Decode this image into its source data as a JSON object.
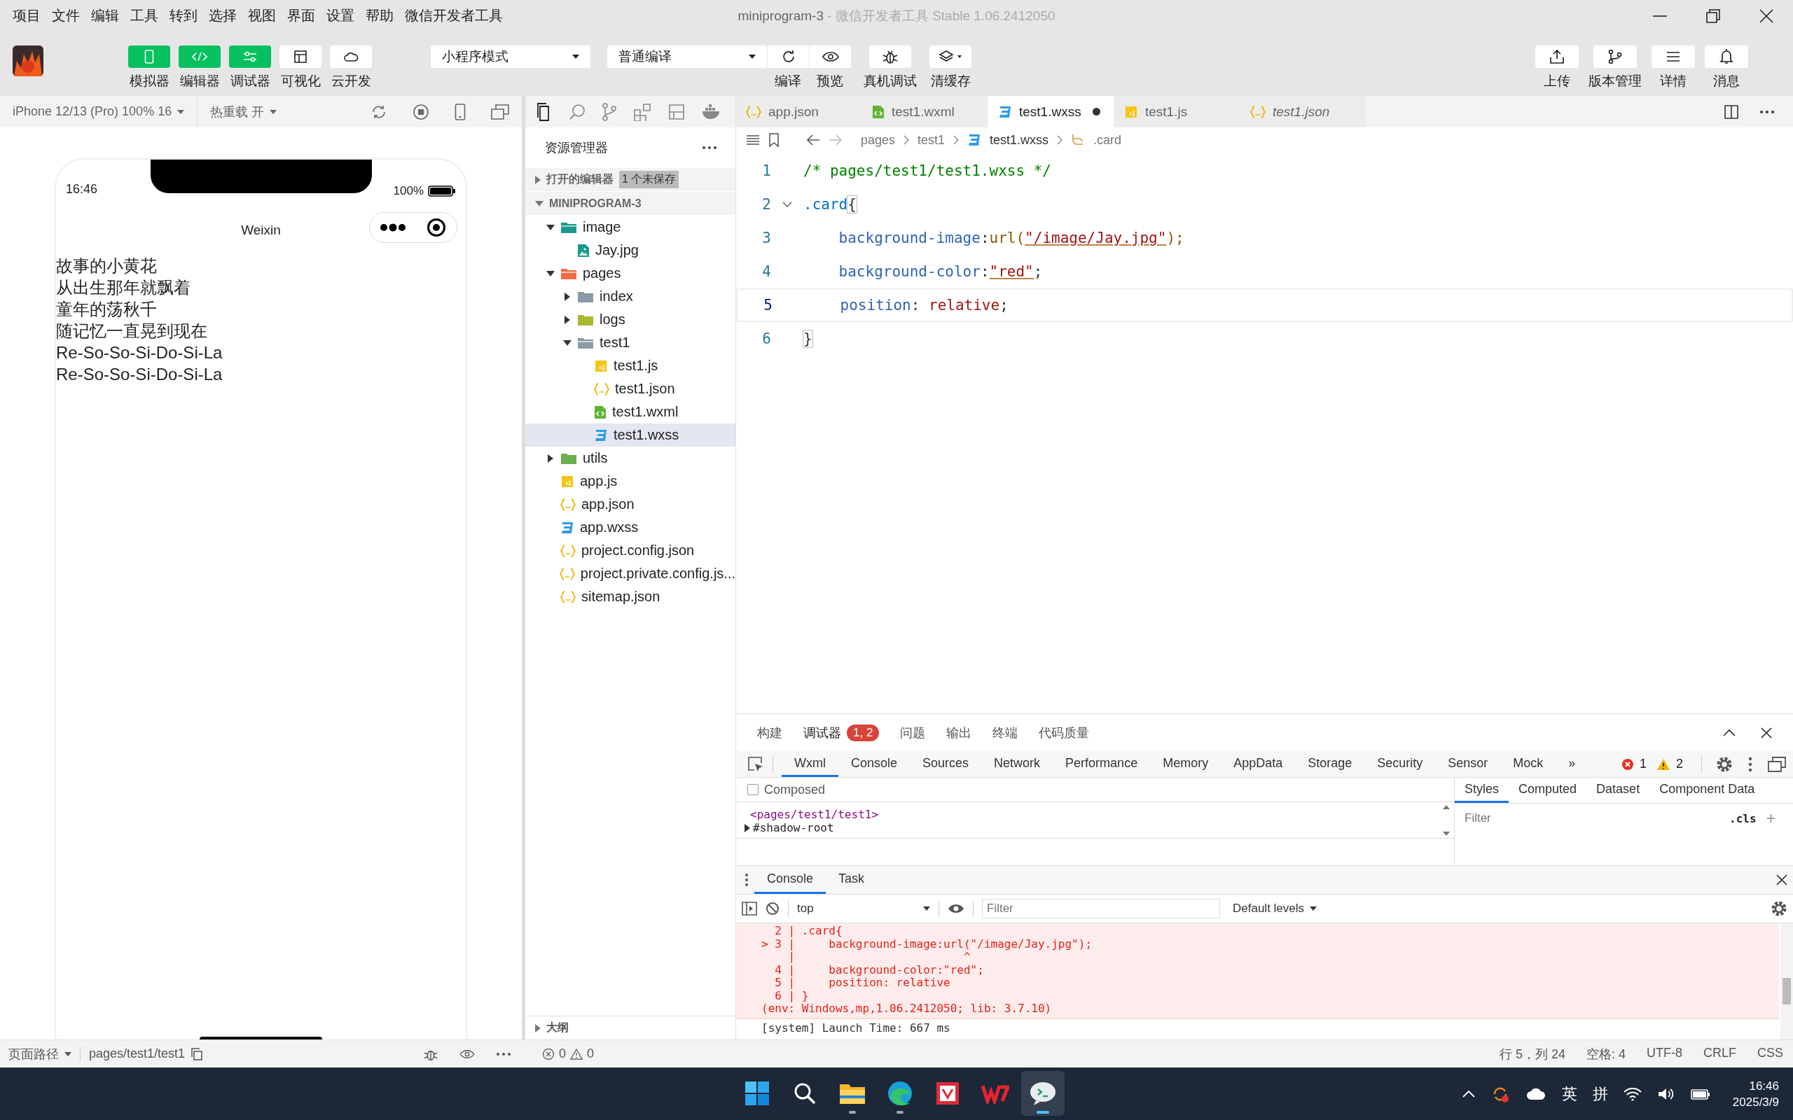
{
  "menu": [
    "项目",
    "文件",
    "编辑",
    "工具",
    "转到",
    "选择",
    "视图",
    "界面",
    "设置",
    "帮助",
    "微信开发者工具"
  ],
  "window": {
    "title": "miniprogram-3",
    "subtitle": "- 微信开发者工具 Stable 1.06.2412050"
  },
  "toolbar": {
    "views": [
      {
        "label": "模拟器",
        "selected": true
      },
      {
        "label": "编辑器",
        "selected": true
      },
      {
        "label": "调试器",
        "selected": true
      },
      {
        "label": "可视化",
        "selected": false
      },
      {
        "label": "云开发",
        "selected": false
      }
    ],
    "mode": "小程序模式",
    "compile": "普通编译",
    "actions": [
      "编译",
      "预览",
      "真机调试",
      "清缓存"
    ],
    "right": [
      "上传",
      "版本管理",
      "详情",
      "消息"
    ]
  },
  "simulator": {
    "device": "iPhone 12/13 (Pro) 100% 16",
    "hot_reload": "热重载 开",
    "time": "16:46",
    "battery": "100%",
    "nav_title": "Weixin",
    "lines": [
      "故事的小黄花",
      "从出生那年就飘着",
      "童年的荡秋千",
      "随记忆一直晃到现在",
      "Re-So-So-Si-Do-Si-La",
      "Re-So-So-Si-Do-Si-La"
    ]
  },
  "explorer": {
    "title": "资源管理器",
    "open_editors": "打开的编辑器",
    "unsaved": "1 个未保存",
    "project": "MINIPROGRAM-3",
    "outline": "大纲",
    "tree": [
      {
        "name": "image",
        "kind": "folder",
        "color": "#1a9a8a",
        "expanded": true,
        "selected": false,
        "children": [
          {
            "name": "Jay.jpg",
            "kind": "image",
            "selected": false
          }
        ]
      },
      {
        "name": "pages",
        "kind": "folder",
        "color": "#f06a45",
        "expanded": true,
        "selected": false,
        "children": [
          {
            "name": "index",
            "kind": "folder",
            "color": "#8a9aa8",
            "expanded": false,
            "selected": false
          },
          {
            "name": "logs",
            "kind": "folder",
            "color": "#a8b830",
            "expanded": false,
            "selected": false
          },
          {
            "name": "test1",
            "kind": "folder",
            "color": "#8a9aa8",
            "expanded": true,
            "selected": false,
            "children": [
              {
                "name": "test1.js",
                "kind": "js",
                "selected": false
              },
              {
                "name": "test1.json",
                "kind": "json",
                "selected": false
              },
              {
                "name": "test1.wxml",
                "kind": "wxml",
                "selected": false
              },
              {
                "name": "test1.wxss",
                "kind": "wxss",
                "selected": true
              }
            ]
          }
        ]
      },
      {
        "name": "utils",
        "kind": "folder",
        "color": "#6ab04c",
        "expanded": false,
        "selected": false
      },
      {
        "name": "app.js",
        "kind": "js",
        "selected": false
      },
      {
        "name": "app.json",
        "kind": "json",
        "selected": false
      },
      {
        "name": "app.wxss",
        "kind": "wxss",
        "selected": false
      },
      {
        "name": "project.config.json",
        "kind": "json",
        "selected": false
      },
      {
        "name": "project.private.config.js...",
        "kind": "json",
        "selected": false
      },
      {
        "name": "sitemap.json",
        "kind": "json",
        "selected": false
      }
    ]
  },
  "editor": {
    "tabs": [
      {
        "label": "app.json",
        "kind": "json",
        "selected": false,
        "preview": false,
        "modified": false
      },
      {
        "label": "test1.wxml",
        "kind": "wxml",
        "selected": false,
        "preview": false,
        "modified": false
      },
      {
        "label": "test1.wxss",
        "kind": "wxss",
        "selected": true,
        "preview": false,
        "modified": true
      },
      {
        "label": "test1.js",
        "kind": "js",
        "selected": false,
        "preview": false,
        "modified": false
      },
      {
        "label": "test1.json",
        "kind": "json",
        "selected": false,
        "preview": true,
        "modified": false
      }
    ],
    "breadcrumb": [
      "pages",
      "test1",
      "test1.wxss",
      ".card"
    ],
    "lines": [
      {
        "number": "1",
        "current": false,
        "tokens": [
          {
            "text": "/* pages/test1/test1.wxss */",
            "kind": "comment"
          }
        ]
      },
      {
        "number": "2",
        "current": false,
        "tokens": [
          {
            "text": ".card",
            "kind": "selector"
          },
          {
            "text": "{",
            "kind": "bracket"
          }
        ]
      },
      {
        "number": "3",
        "current": false,
        "tokens": [
          {
            "text": "    background-image",
            "kind": "property"
          },
          {
            "text": ":",
            "kind": "punct"
          },
          {
            "text": "url(",
            "kind": "func"
          },
          {
            "text": "\"/image/Jay.jpg\"",
            "kind": "string"
          },
          {
            "text": ");",
            "kind": "func"
          }
        ]
      },
      {
        "number": "4",
        "current": false,
        "tokens": [
          {
            "text": "    background-color",
            "kind": "property"
          },
          {
            "text": ":",
            "kind": "punct"
          },
          {
            "text": "\"red\"",
            "kind": "string"
          },
          {
            "text": ";",
            "kind": "punct"
          }
        ]
      },
      {
        "number": "5",
        "current": true,
        "tokens": [
          {
            "text": "    position",
            "kind": "property"
          },
          {
            "text": ": ",
            "kind": "punct"
          },
          {
            "text": "relative",
            "kind": "value"
          },
          {
            "text": ";",
            "kind": "punct"
          }
        ]
      },
      {
        "number": "6",
        "current": false,
        "tokens": [
          {
            "text": "}",
            "kind": "bracket"
          }
        ]
      }
    ]
  },
  "debugger": {
    "tabs": [
      {
        "label": "构建",
        "selected": false
      },
      {
        "label": "调试器",
        "selected": true,
        "badge": "1, 2"
      },
      {
        "label": "问题",
        "selected": false
      },
      {
        "label": "输出",
        "selected": false
      },
      {
        "label": "终端",
        "selected": false
      },
      {
        "label": "代码质量",
        "selected": false
      }
    ],
    "devtools_tabs": [
      {
        "label": "Wxml",
        "selected": true
      },
      {
        "label": "Console",
        "selected": false
      },
      {
        "label": "Sources",
        "selected": false
      },
      {
        "label": "Network",
        "selected": false
      },
      {
        "label": "Performance",
        "selected": false
      },
      {
        "label": "Memory",
        "selected": false
      },
      {
        "label": "AppData",
        "selected": false
      },
      {
        "label": "Storage",
        "selected": false
      },
      {
        "label": "Security",
        "selected": false
      },
      {
        "label": "Sensor",
        "selected": false
      },
      {
        "label": "Mock",
        "selected": false
      }
    ],
    "more": "»",
    "errors": "1",
    "warnings": "2",
    "composed": {
      "label": "Composed",
      "checked": false
    },
    "wxml": {
      "tag": "<pages/test1/test1>",
      "child": "#shadow-root"
    },
    "style_tabs": [
      {
        "label": "Styles",
        "selected": true
      },
      {
        "label": "Computed",
        "selected": false
      },
      {
        "label": "Dataset",
        "selected": false
      },
      {
        "label": "Component Data",
        "selected": false
      }
    ],
    "style_filter": {
      "placeholder": "Filter"
    },
    "cls": ".cls",
    "plus": "+",
    "drawer_tabs": [
      {
        "label": "Console",
        "selected": true
      },
      {
        "label": "Task",
        "selected": false
      }
    ],
    "context": "top",
    "filter": {
      "placeholder": "Filter"
    },
    "levels": "Default levels",
    "error_lines": [
      "  2 | .card{",
      "> 3 |     background-image:url(\"/image/Jay.jpg\");",
      "    |                         ^",
      "  4 |     background-color:\"red\";",
      "  5 |     position: relative",
      "  6 | }",
      "(env: Windows,mp,1.06.2412050; lib: 3.7.10)"
    ],
    "log": "[system] Launch Time: 667 ms"
  },
  "status": {
    "page_path": "页面路径",
    "path": "pages/test1/test1",
    "errors": "0",
    "warnings": "0",
    "items": [
      "行 5，列 24",
      "空格: 4",
      "UTF-8",
      "CRLF",
      "CSS"
    ]
  },
  "taskbar": {
    "apps": [
      {
        "running": false,
        "selected": false
      },
      {
        "running": false,
        "selected": false
      },
      {
        "running": true,
        "selected": false
      },
      {
        "running": true,
        "selected": false
      },
      {
        "running": false,
        "selected": false
      },
      {
        "running": false,
        "selected": false
      },
      {
        "running": true,
        "selected": true
      }
    ],
    "ime": [
      "英",
      "拼"
    ],
    "time": "16:46",
    "date": "2025/3/9"
  }
}
